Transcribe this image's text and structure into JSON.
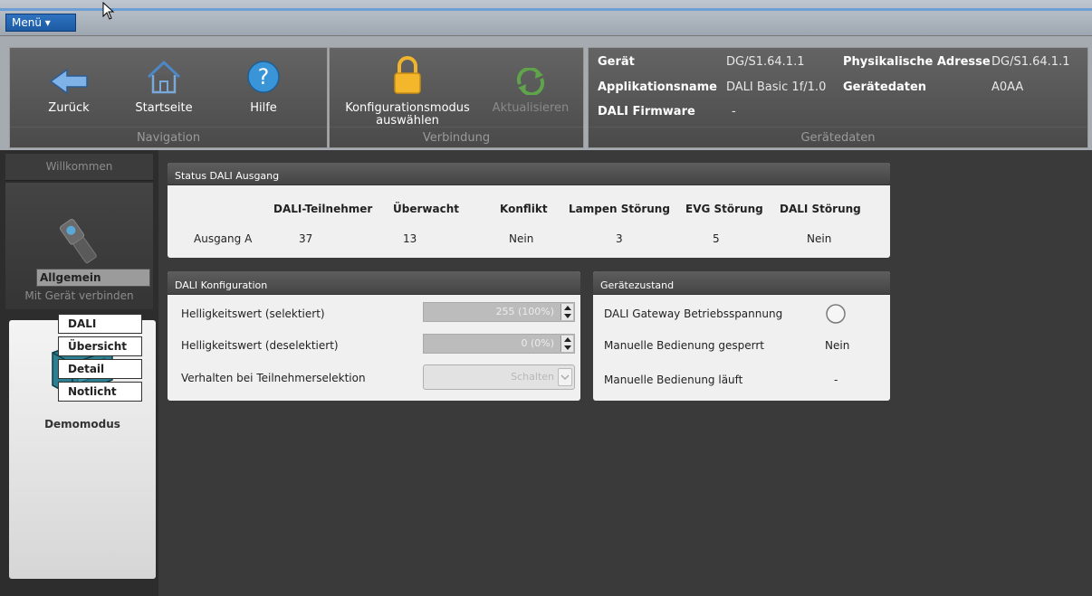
{
  "menu": {
    "label": "Menü ▾"
  },
  "ribbon": {
    "navigation": {
      "caption": "Navigation",
      "back": "Zurück",
      "home": "Startseite",
      "help": "Hilfe"
    },
    "connection": {
      "caption": "Verbindung",
      "config_mode_line1": "Konfigurationsmodus",
      "config_mode_line2": "auswählen",
      "refresh": "Aktualisieren"
    },
    "device_data": {
      "caption": "Gerätedaten",
      "device_label": "Gerät",
      "device_value": "DG/S1.64.1.1",
      "app_label": "Applikationsname",
      "app_value": "DALI Basic 1f/1.0",
      "firmware_label": "DALI Firmware",
      "firmware_value": "-",
      "phys_label": "Physikalische Adresse",
      "phys_value": "DG/S1.64.1.1",
      "devdata_label": "Gerätedaten",
      "devdata_value": "A0AA"
    }
  },
  "sidebar": {
    "welcome": "Willkommen",
    "connect": "Mit Gerät verbinden",
    "demo": "Demomodus",
    "tree": {
      "parent": "Allgemein",
      "items": [
        "DALI",
        "Übersicht",
        "Detail",
        "Notlicht"
      ]
    }
  },
  "status_panel": {
    "title": "Status DALI Ausgang",
    "headers": [
      "DALI-Teilnehmer",
      "Überwacht",
      "Konflikt",
      "Lampen Störung",
      "EVG Störung",
      "DALI Störung"
    ],
    "rows": [
      {
        "label": "Ausgang A",
        "values": [
          "37",
          "13",
          "Nein",
          "3",
          "5",
          "Nein"
        ]
      }
    ]
  },
  "config_panel": {
    "title": "DALI Konfiguration",
    "brightness_selected_label": "Helligkeitswert (selektiert)",
    "brightness_selected_value": "255 (100%)",
    "brightness_deselected_label": "Helligkeitswert (deselektiert)",
    "brightness_deselected_value": "0 (0%)",
    "behaviour_label": "Verhalten bei Teilnehmerselektion",
    "behaviour_value": "Schalten"
  },
  "device_state_panel": {
    "title": "Gerätezustand",
    "supply_label": "DALI Gateway Betriebsspannung",
    "manual_locked_label": "Manuelle Bedienung gesperrt",
    "manual_locked_value": "Nein",
    "manual_running_label": "Manuelle Bedienung läuft",
    "manual_running_value": "-"
  },
  "colors": {
    "menu_button": "#2f73c0",
    "panel_header": "#4e4e4e",
    "background": "#3a3a3a"
  }
}
